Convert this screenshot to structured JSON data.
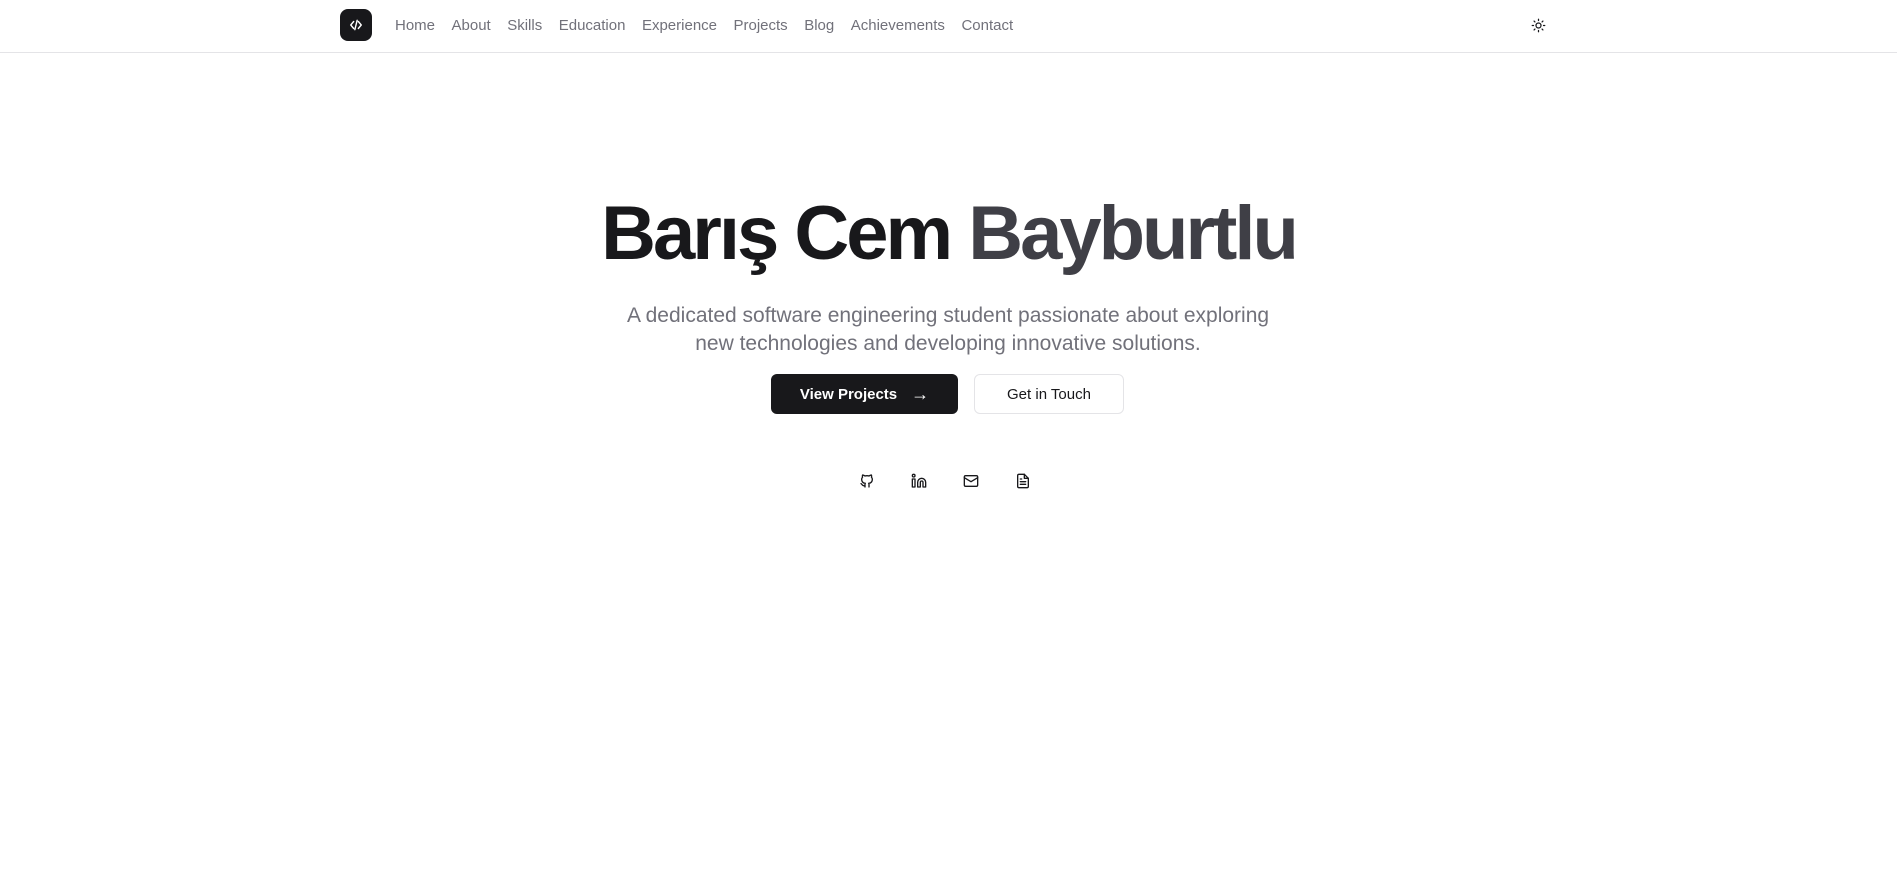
{
  "nav": {
    "logo_icon": "code-icon",
    "links": [
      {
        "label": "Home"
      },
      {
        "label": "About"
      },
      {
        "label": "Skills"
      },
      {
        "label": "Education"
      },
      {
        "label": "Experience"
      },
      {
        "label": "Projects"
      },
      {
        "label": "Blog"
      },
      {
        "label": "Achievements"
      },
      {
        "label": "Contact"
      }
    ],
    "theme_icon": "sun-icon"
  },
  "hero": {
    "first_name": "Barış Cem",
    "last_name": "Bayburtlu",
    "subtitle_line1": "A dedicated software engineering student passionate about exploring",
    "subtitle_line2": "new technologies and developing innovative solutions.",
    "primary_button": "View Projects",
    "primary_arrow": "→",
    "secondary_button": "Get in Touch"
  },
  "socials": [
    {
      "icon": "github-icon"
    },
    {
      "icon": "linkedin-icon"
    },
    {
      "icon": "mail-icon"
    },
    {
      "icon": "document-icon"
    }
  ],
  "colors": {
    "primary": "#18181b",
    "muted_text": "#71717a",
    "border": "#e4e4e7",
    "background": "#ffffff"
  }
}
